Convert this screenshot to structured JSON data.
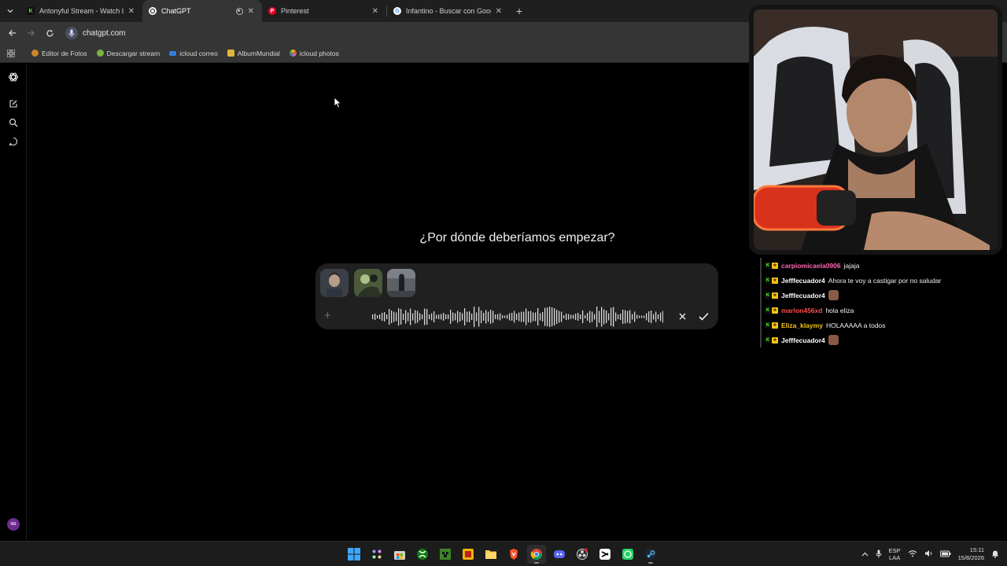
{
  "browser": {
    "tabs": [
      {
        "title": "Antonyful Stream - Watch Live",
        "favicon": "kick-icon",
        "active": false
      },
      {
        "title": "ChatGPT",
        "favicon": "chatgpt-icon",
        "active": true
      },
      {
        "title": "Pinterest",
        "favicon": "pinterest-icon",
        "active": false
      },
      {
        "title": "Infantino - Buscar con Google",
        "favicon": "google-icon",
        "active": false
      }
    ],
    "url": "chatgpt.com",
    "bookmarks": [
      {
        "label": "Editor de Fotos",
        "color": "#c9852b"
      },
      {
        "label": "Descargar stream",
        "color": "#7cb342"
      },
      {
        "label": "icloud correo",
        "color": "#2f7de1"
      },
      {
        "label": "AlbumMundial",
        "color": "#e2b43a"
      },
      {
        "label": "icloud photos",
        "color": "#d86ea8"
      }
    ]
  },
  "chatgpt": {
    "greeting": "¿Por dónde deberíamos empezar?",
    "avatar_initials": "NS",
    "attachments": [
      "image-thumbnail-1",
      "image-thumbnail-2",
      "image-thumbnail-3"
    ]
  },
  "stream_chat": [
    {
      "user": "carpiomicaela0906",
      "color": "#ff69b4",
      "message": "jajaja",
      "emote": false
    },
    {
      "user": "Jefffecuador4",
      "color": "#ffffff",
      "message": "Ahora te voy a castigar por no saludar",
      "emote": false
    },
    {
      "user": "Jefffecuador4",
      "color": "#ffffff",
      "message": "",
      "emote": true
    },
    {
      "user": "marlon456xd",
      "color": "#ff4d4d",
      "message": "hola eliza",
      "emote": false
    },
    {
      "user": "Eliza_klaymy",
      "color": "#f5c518",
      "message": "HOLAAAAA a todos",
      "emote": false
    },
    {
      "user": "Jefffecuador4",
      "color": "#ffffff",
      "message": "",
      "emote": true
    }
  ],
  "taskbar": {
    "language_line1": "ESP",
    "language_line2": "LAA",
    "time": "15:11",
    "date": "15/8/2026"
  },
  "colors": {
    "accent_chrome": "#353535",
    "page_bg": "#000000",
    "composer_bg": "#202020",
    "kick_green": "#53fc18"
  }
}
